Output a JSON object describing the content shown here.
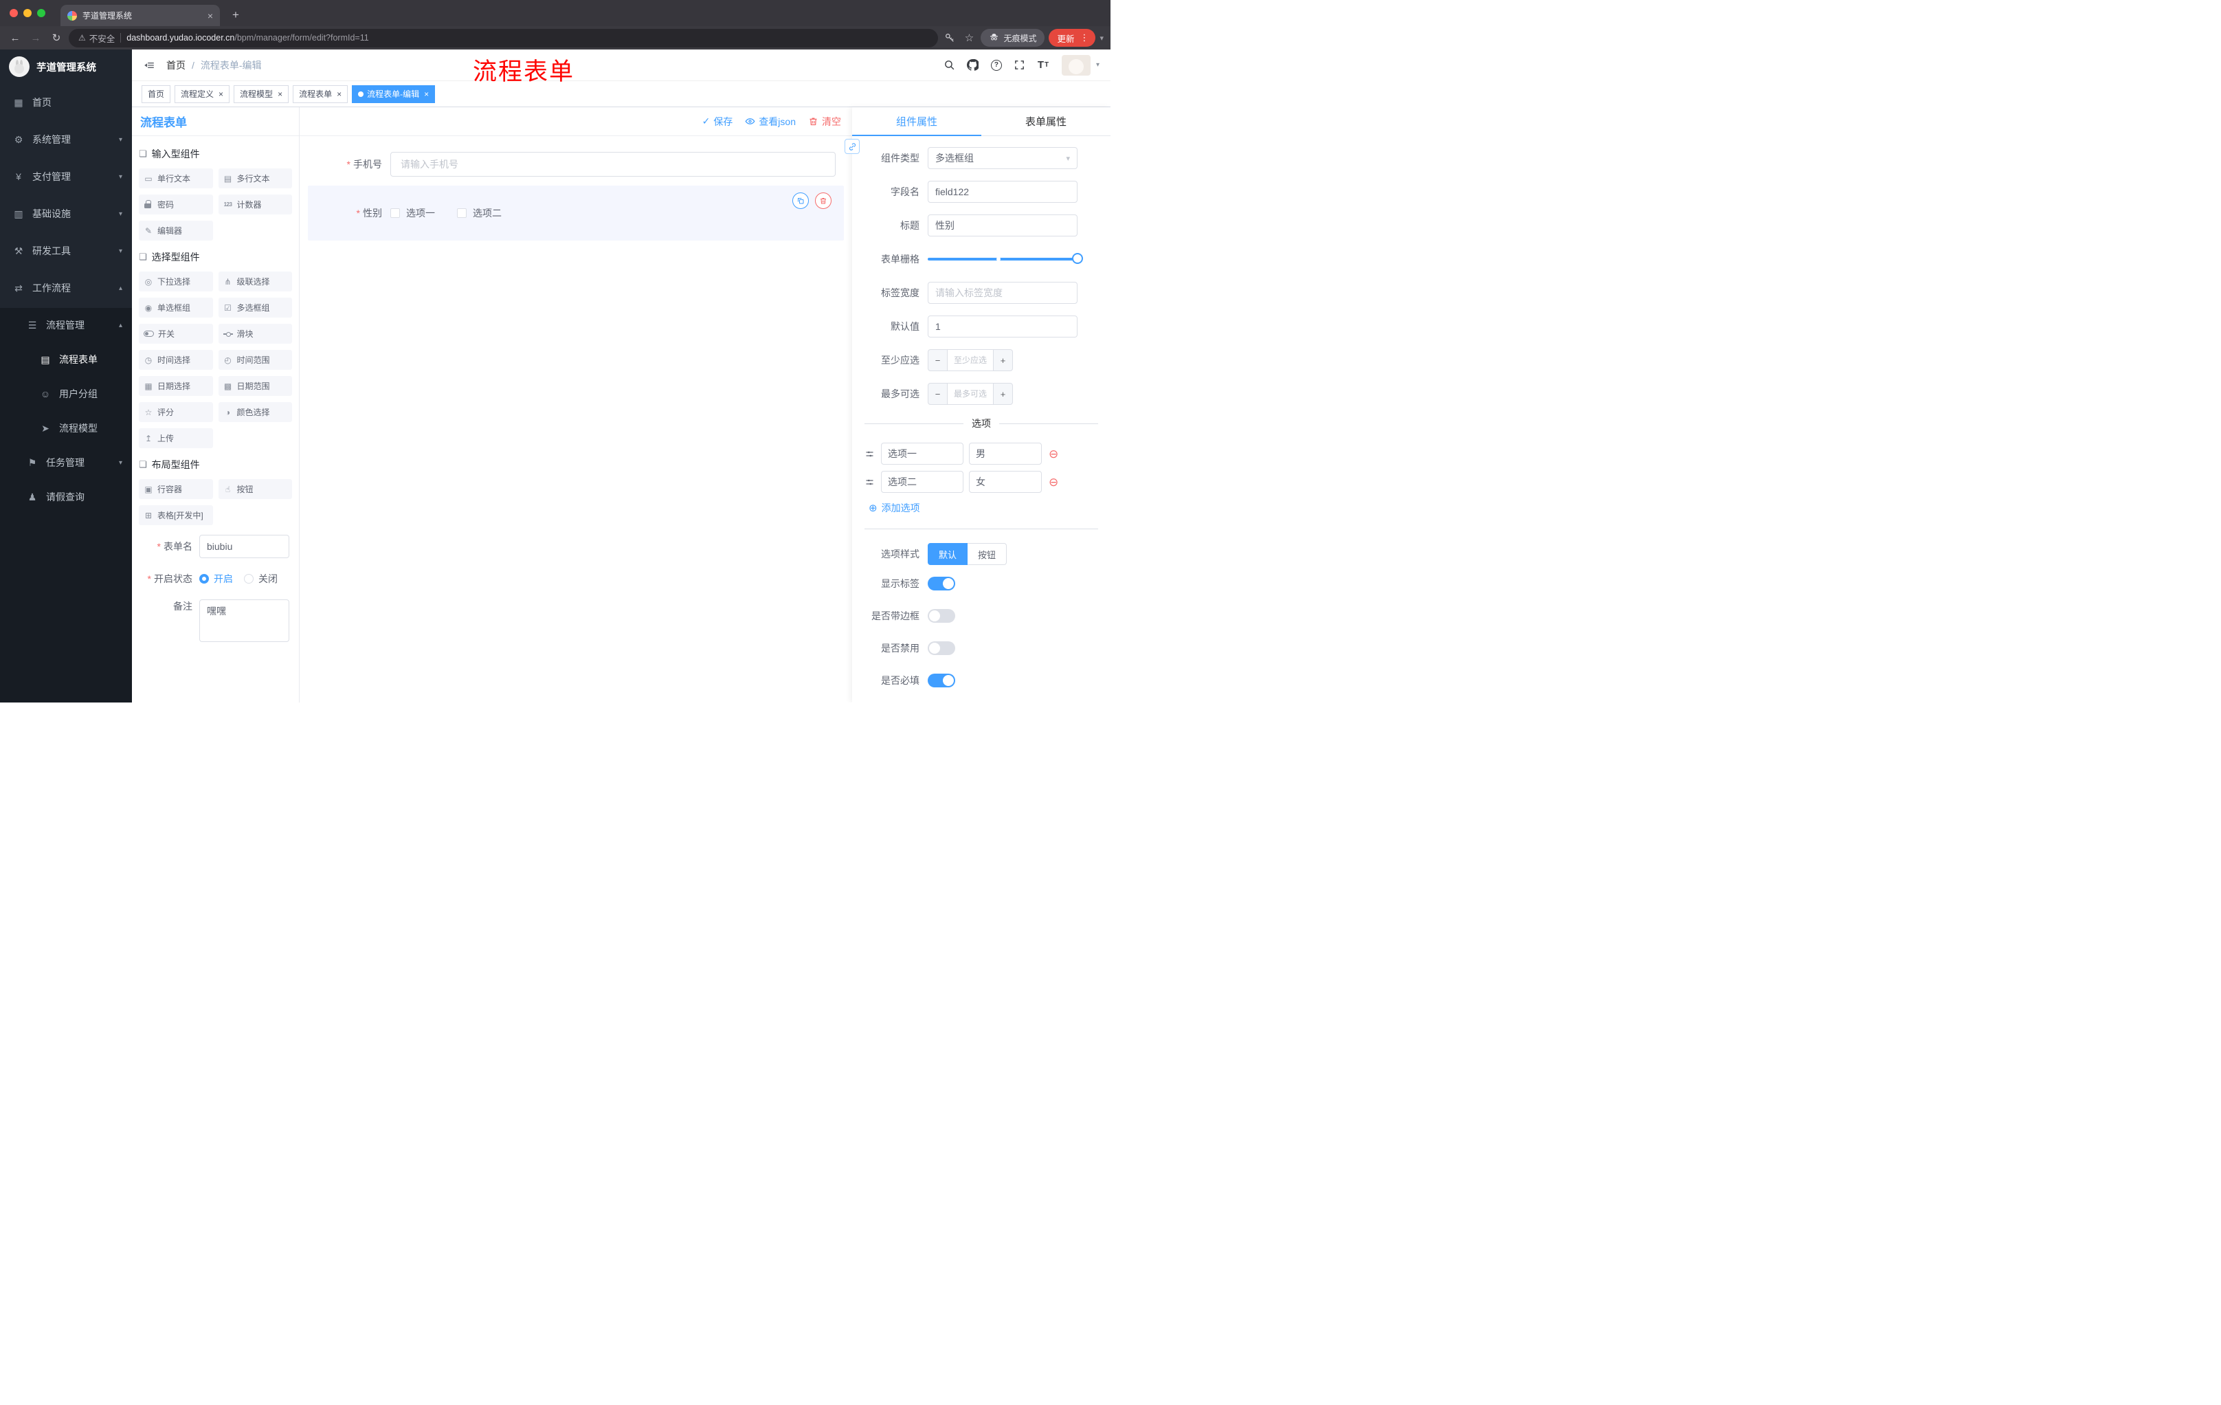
{
  "browser": {
    "tab_title": "芋道管理系统",
    "security_label": "不安全",
    "url_host": "dashboard.yudao.iocoder.cn",
    "url_path": "/bpm/manager/form/edit?formId=11",
    "incognito_label": "无痕模式",
    "update_label": "更新"
  },
  "sidebar": {
    "app_title": "芋道管理系统",
    "menu": [
      {
        "label": "首页"
      },
      {
        "label": "系统管理"
      },
      {
        "label": "支付管理"
      },
      {
        "label": "基础设施"
      },
      {
        "label": "研发工具"
      },
      {
        "label": "工作流程"
      },
      {
        "label": "流程管理"
      },
      {
        "label": "流程表单",
        "active": true
      },
      {
        "label": "用户分组"
      },
      {
        "label": "流程模型"
      },
      {
        "label": "任务管理"
      },
      {
        "label": "请假查询"
      }
    ]
  },
  "header": {
    "breadcrumb_home": "首页",
    "breadcrumb_sep": "/",
    "breadcrumb_current": "流程表单-编辑",
    "annotation": "流程表单"
  },
  "tags": [
    {
      "label": "首页",
      "closable": false,
      "active": false
    },
    {
      "label": "流程定义",
      "closable": true,
      "active": false
    },
    {
      "label": "流程模型",
      "closable": true,
      "active": false
    },
    {
      "label": "流程表单",
      "closable": true,
      "active": false
    },
    {
      "label": "流程表单-编辑",
      "closable": true,
      "active": true
    }
  ],
  "designer": {
    "panel_title": "流程表单",
    "toolbar": {
      "save": "保存",
      "view_json": "查看json",
      "clear": "清空"
    },
    "palette": [
      {
        "title": "输入型组件",
        "items": [
          "单行文本",
          "多行文本",
          "密码",
          "计数器",
          "编辑器"
        ]
      },
      {
        "title": "选择型组件",
        "items": [
          "下拉选择",
          "级联选择",
          "单选框组",
          "多选框组",
          "开关",
          "滑块",
          "时间选择",
          "时间范围",
          "日期选择",
          "日期范围",
          "评分",
          "颜色选择",
          "上传"
        ]
      },
      {
        "title": "布局型组件",
        "items": [
          "行容器",
          "按钮",
          "表格[开发中]"
        ]
      }
    ],
    "meta": {
      "form_name_label": "表单名",
      "form_name_value": "biubiu",
      "status_label": "开启状态",
      "status_on": "开启",
      "status_off": "关闭",
      "status_selected": "开启",
      "remark_label": "备注",
      "remark_value": "嘿嘿"
    },
    "canvas": {
      "phone_label": "手机号",
      "phone_placeholder": "请输入手机号",
      "gender_label": "性别",
      "gender_option1": "选项一",
      "gender_option2": "选项二"
    }
  },
  "props": {
    "tab_component": "组件属性",
    "tab_form": "表单属性",
    "rows": {
      "type_label": "组件类型",
      "type_value": "多选框组",
      "field_label": "字段名",
      "field_value": "field122",
      "title_label": "标题",
      "title_value": "性别",
      "grid_label": "表单栅格",
      "labelw_label": "标签宽度",
      "labelw_placeholder": "请输入标签宽度",
      "default_label": "默认值",
      "default_value": "1",
      "min_label": "至少应选",
      "min_placeholder": "至少应选",
      "max_label": "最多可选",
      "max_placeholder": "最多可选"
    },
    "options_title": "选项",
    "options": [
      {
        "label": "选项一",
        "value": "男"
      },
      {
        "label": "选项二",
        "value": "女"
      }
    ],
    "add_option": "添加选项",
    "style_label": "选项样式",
    "style_default": "默认",
    "style_button": "按钮",
    "toggles": [
      {
        "label": "显示标签",
        "on": true
      },
      {
        "label": "是否带边框",
        "on": false
      },
      {
        "label": "是否禁用",
        "on": false
      },
      {
        "label": "是否必填",
        "on": true
      }
    ]
  },
  "icons": {
    "single_line": "▭",
    "multi_line": "▤",
    "counter": "123",
    "editor": "✎",
    "select": "◎",
    "cascader": "⋔",
    "radio_group": "◉",
    "checkbox_group": "☑",
    "time": "◷",
    "time_range": "◴",
    "date": "▦",
    "date_range": "▩",
    "rate": "☆",
    "color": "◑",
    "upload": "↥",
    "row_container": "▣",
    "button": "☝",
    "table": "⊞",
    "group": "❏",
    "menu_home": "▦",
    "menu_system": "⚙",
    "menu_pay": "¥",
    "menu_infra": "▥",
    "menu_dev": "⚒",
    "menu_flow": "⇄",
    "menu_process": "☰",
    "menu_form": "▤",
    "menu_group": "☺",
    "menu_model": "➤",
    "menu_task": "⚑",
    "menu_leave": "♟",
    "check": "✓",
    "star": "☆",
    "warning": "⚠",
    "back": "←",
    "forward": "→",
    "reload": "↻",
    "kebab": "⋮",
    "caret_down": "▾",
    "caret_up": "▴",
    "plus_circle": "⊕",
    "minus_circle": "⊖",
    "minus": "−",
    "plus": "+",
    "close": "×",
    "question": "?"
  },
  "colors": {
    "accent": "#409eff",
    "danger": "#f56c6c",
    "sidebar_bg": "#171c23",
    "annotation_red": "#fe0602",
    "active_tag_bg": "#409eff",
    "update_button_bg": "#e5473d"
  }
}
